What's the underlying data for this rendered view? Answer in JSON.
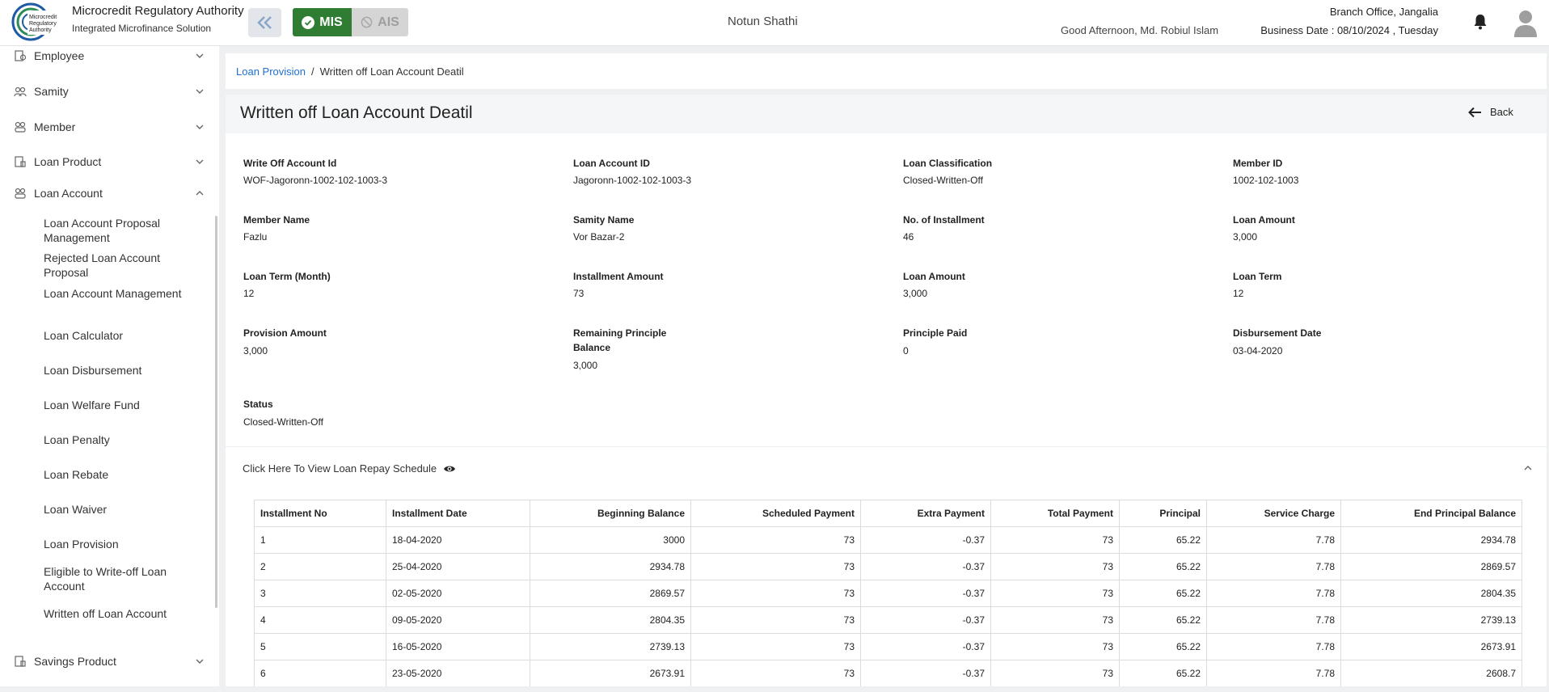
{
  "header": {
    "org_title": "Microcredit Regulatory Authority",
    "org_subtitle": "Integrated Microfinance Solution",
    "logo_text": "Microcredit Regulatory Authority",
    "mis_label": "MIS",
    "ais_label": "AIS",
    "center_title": "Notun Shathi",
    "greeting": "Good Afternoon, Md. Robiul Islam",
    "branch": "Branch Office, Jangalia",
    "business_date": "Business Date : 08/10/2024 , Tuesday"
  },
  "sidebar": {
    "items": [
      {
        "label": "Employee",
        "icon": "employee-icon"
      },
      {
        "label": "Samity",
        "icon": "samity-icon"
      },
      {
        "label": "Member",
        "icon": "member-icon"
      },
      {
        "label": "Loan Product",
        "icon": "loan-product-icon"
      },
      {
        "label": "Loan Account",
        "icon": "loan-account-icon"
      },
      {
        "label": "Savings Product",
        "icon": "savings-product-icon"
      }
    ],
    "loan_account_sub": [
      "Loan Account Proposal Management",
      "Rejected Loan Account Proposal",
      "Loan Account Management",
      "Loan Calculator",
      "Loan Disbursement",
      "Loan Welfare Fund",
      "Loan Penalty",
      "Loan Rebate",
      "Loan Waiver",
      "Loan Provision",
      "Eligible to Write-off Loan Account",
      "Written off Loan Account"
    ]
  },
  "breadcrumb": {
    "parent": "Loan Provision",
    "separator": "/",
    "current": "Written off Loan Account Deatil"
  },
  "page": {
    "title": "Written off Loan Account Deatil",
    "back_label": "Back"
  },
  "fields": [
    {
      "label": "Write Off Account Id",
      "value": "WOF-Jagoronn-1002-102-1003-3"
    },
    {
      "label": "Loan Account ID",
      "value": "Jagoronn-1002-102-1003-3"
    },
    {
      "label": "Loan Classification",
      "value": "Closed-Written-Off"
    },
    {
      "label": "Member ID",
      "value": "1002-102-1003"
    },
    {
      "label": "Member Name",
      "value": "Fazlu"
    },
    {
      "label": "Samity Name",
      "value": "Vor Bazar-2"
    },
    {
      "label": "No. of Installment",
      "value": "46"
    },
    {
      "label": "Loan Amount",
      "value": "3,000"
    },
    {
      "label": "Loan Term (Month)",
      "value": "12"
    },
    {
      "label": "Installment Amount",
      "value": "73"
    },
    {
      "label": "Loan Amount",
      "value": "3,000"
    },
    {
      "label": "Loan Term",
      "value": "12"
    },
    {
      "label": "Provision Amount",
      "value": "3,000"
    },
    {
      "label": "Remaining Principle Balance",
      "value": "3,000"
    },
    {
      "label": "Principle Paid",
      "value": "0"
    },
    {
      "label": "Disbursement Date",
      "value": "03-04-2020"
    },
    {
      "label": "Status",
      "value": "Closed-Written-Off"
    }
  ],
  "repay": {
    "toggle_label": "Click Here To View Loan Repay Schedule",
    "columns": [
      "Installment No",
      "Installment Date",
      "Beginning Balance",
      "Scheduled Payment",
      "Extra Payment",
      "Total Payment",
      "Principal",
      "Service Charge",
      "End Principal Balance"
    ],
    "rows": [
      [
        "1",
        "18-04-2020",
        "3000",
        "73",
        "-0.37",
        "73",
        "65.22",
        "7.78",
        "2934.78"
      ],
      [
        "2",
        "25-04-2020",
        "2934.78",
        "73",
        "-0.37",
        "73",
        "65.22",
        "7.78",
        "2869.57"
      ],
      [
        "3",
        "02-05-2020",
        "2869.57",
        "73",
        "-0.37",
        "73",
        "65.22",
        "7.78",
        "2804.35"
      ],
      [
        "4",
        "09-05-2020",
        "2804.35",
        "73",
        "-0.37",
        "73",
        "65.22",
        "7.78",
        "2739.13"
      ],
      [
        "5",
        "16-05-2020",
        "2739.13",
        "73",
        "-0.37",
        "73",
        "65.22",
        "7.78",
        "2673.91"
      ],
      [
        "6",
        "23-05-2020",
        "2673.91",
        "73",
        "-0.37",
        "73",
        "65.22",
        "7.78",
        "2608.7"
      ]
    ]
  },
  "colors": {
    "mis_green": "#2e7d32",
    "link_blue": "#1e6fd0",
    "ais_disabled": "#d5d5d5"
  }
}
